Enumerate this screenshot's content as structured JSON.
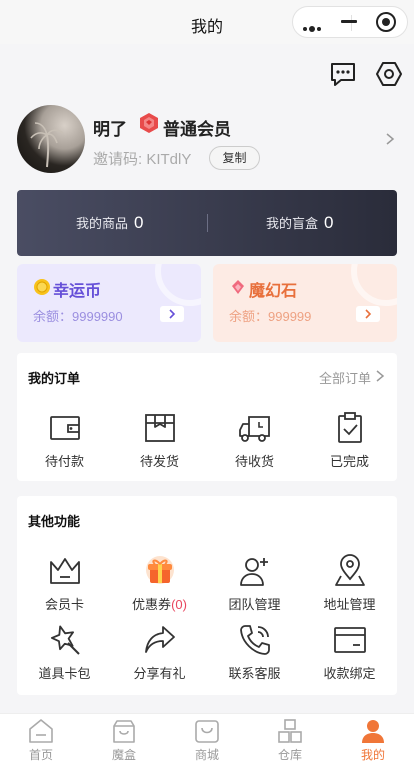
{
  "nav": {
    "title": "我的"
  },
  "profile": {
    "name": "明了",
    "member_level": "普通会员",
    "invite_code": "邀请码: KITdlY",
    "copy_label": "复制"
  },
  "stats": [
    {
      "label": "我的商品",
      "value": "0"
    },
    {
      "label": "我的盲盒",
      "value": "0"
    }
  ],
  "coins": [
    {
      "title": "幸运币",
      "balance": "余额：9999990",
      "icon": "gold-coin-icon",
      "color": "#6650d8"
    },
    {
      "title": "魔幻石",
      "balance": "余额：999999",
      "icon": "magic-stone-icon",
      "color": "#e8703c"
    }
  ],
  "orders": {
    "title": "我的订单",
    "all_link": "全部订单",
    "items": [
      {
        "label": "待付款",
        "icon": "wallet-icon"
      },
      {
        "label": "待发货",
        "icon": "box-icon"
      },
      {
        "label": "待收货",
        "icon": "truck-icon"
      },
      {
        "label": "已完成",
        "icon": "clipboard-check-icon"
      }
    ]
  },
  "functions": {
    "title": "其他功能",
    "items": [
      {
        "label": "会员卡",
        "icon": "crown-icon"
      },
      {
        "label": "优惠券",
        "count": "(0)",
        "icon": "gift-icon"
      },
      {
        "label": "团队管理",
        "icon": "user-add-icon"
      },
      {
        "label": "地址管理",
        "icon": "map-pin-icon"
      },
      {
        "label": "道具卡包",
        "icon": "magic-wand-icon"
      },
      {
        "label": "分享有礼",
        "icon": "share-icon"
      },
      {
        "label": "联系客服",
        "icon": "phone-icon"
      },
      {
        "label": "收款绑定",
        "icon": "card-icon"
      }
    ]
  },
  "tabbar": [
    {
      "label": "首页",
      "icon": "home-icon"
    },
    {
      "label": "魔盒",
      "icon": "magic-box-icon"
    },
    {
      "label": "商城",
      "icon": "mall-icon"
    },
    {
      "label": "仓库",
      "icon": "warehouse-icon"
    },
    {
      "label": "我的",
      "icon": "user-icon",
      "active": true
    }
  ],
  "colors": {
    "accent": "#f07638",
    "coupon_count": "#e8465e",
    "dark_card": "#2a2c3a"
  }
}
